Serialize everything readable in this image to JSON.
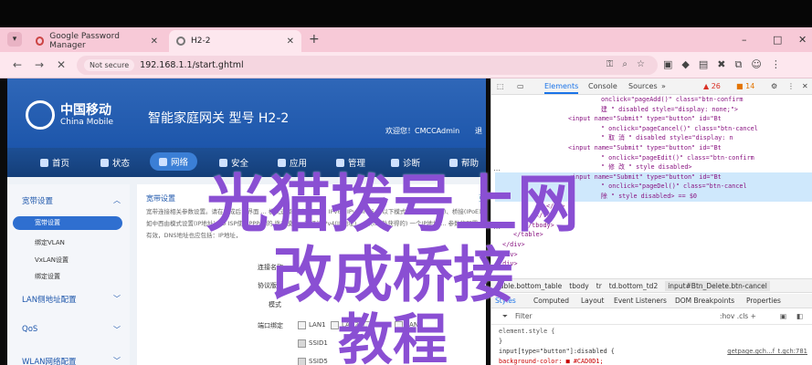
{
  "browser": {
    "tabs": [
      {
        "label": "Google Password Manager",
        "active": false
      },
      {
        "label": "H2-2",
        "active": true
      }
    ],
    "new_tab": "+",
    "window_controls": [
      "–",
      "□",
      "✕"
    ],
    "tab_menu": "▾",
    "address": {
      "security": "Not secure",
      "url": "192.168.1.1/start.ghtml"
    },
    "nav": {
      "back": "←",
      "forward": "→",
      "stop": "✕"
    }
  },
  "router_page": {
    "logo_cn": "中国移动",
    "logo_en": "China Mobile",
    "product_title": "智能家庭网关  型号 H2-2",
    "welcome": "欢迎您！CMCCAdmin",
    "logout": "退",
    "nav": [
      "首页",
      "状态",
      "网络",
      "安全",
      "应用",
      "管理",
      "诊断",
      "帮助"
    ],
    "sidebar": {
      "group1": "宽带设置",
      "items": [
        "宽带设置",
        "绑定VLAN",
        "VxLAN设置",
        "绑定设置"
      ],
      "groups": [
        "LAN侧地址配置",
        "QoS",
        "WLAN网络配置"
      ]
    },
    "content": {
      "title": "宽带设置",
      "more": "更",
      "desc": "宽带连接相关参数设置。请在完成后，界面 ... 模式选择包括：IPv4、IPv6：IPv4/IPv6， 以下模式包括路由(拨号)、桥接(IPoE) 如中西由模式设置(IP地址)，D ISP使用PPPoE的 拨号模式，选择该IPv4(IP地址)， (从ISP处获得的) 一个IP地址 ... 参数的配置。 有效，DNS地址也应包括：IP地址，",
      "labels": [
        "连接名称",
        "协议版本",
        "模式",
        "端口绑定"
      ],
      "ports": [
        "LAN1",
        "LAN2",
        "LAN3",
        "LAN4"
      ],
      "ssids_row1": [
        "SSID1"
      ],
      "ssids_row2": [
        "SSID5"
      ]
    }
  },
  "overlay": {
    "line1": "光猫拨号上网",
    "line2": "改成桥接",
    "line3": "教程"
  },
  "devtools": {
    "tabs": [
      "Elements",
      "Console",
      "Sources"
    ],
    "badge_errors": "▲ 26",
    "badge_warn": "■ 14",
    "code_lines": [
      "onclick=\"pageAdd()\" class=\"btn-confirm",
      "建 \" disabled style=\"display: none;\">",
      "<input name=\"Submit\" type=\"button\" id=\"Bt",
      "\" onclick=\"pageCancel()\" class=\"btn-cancel",
      "\" 取 消 \" disabled style=\"display: n",
      "<input name=\"Submit\" type=\"button\" id=\"Bt",
      "\" onclick=\"pageEdit()\" class=\"btn-confirm",
      "\" 修 改 \" style disabled>",
      "<input name=\"Submit\" type=\"button\" id=\"Bt",
      "\" onclick=\"pageDel()\" class=\"btn-cancel",
      "除 \" style disabled> == $0",
      "</td>",
      "</tr>",
      "</tbody>",
      "</table>",
      "</div>",
      "</div>",
      "</div>"
    ],
    "breadcrumb": [
      "table.bottom_table",
      "tbody",
      "tr",
      "td.bottom_td2",
      "input#Btn_Delete.btn-cancel"
    ],
    "styles_tabs": [
      "Styles",
      "Computed",
      "Layout",
      "Event Listeners",
      "DOM Breakpoints",
      "Properties"
    ],
    "filter_placeholder": "Filter",
    "filter_tools": ":hov  .cls  +",
    "rules": [
      "element.style {",
      "}",
      "input[type=\"button\"]:disabled {",
      "  background-color: ■ #CAD0D1;"
    ],
    "rule_source": "getpage.gch…f_t.gch:781"
  }
}
